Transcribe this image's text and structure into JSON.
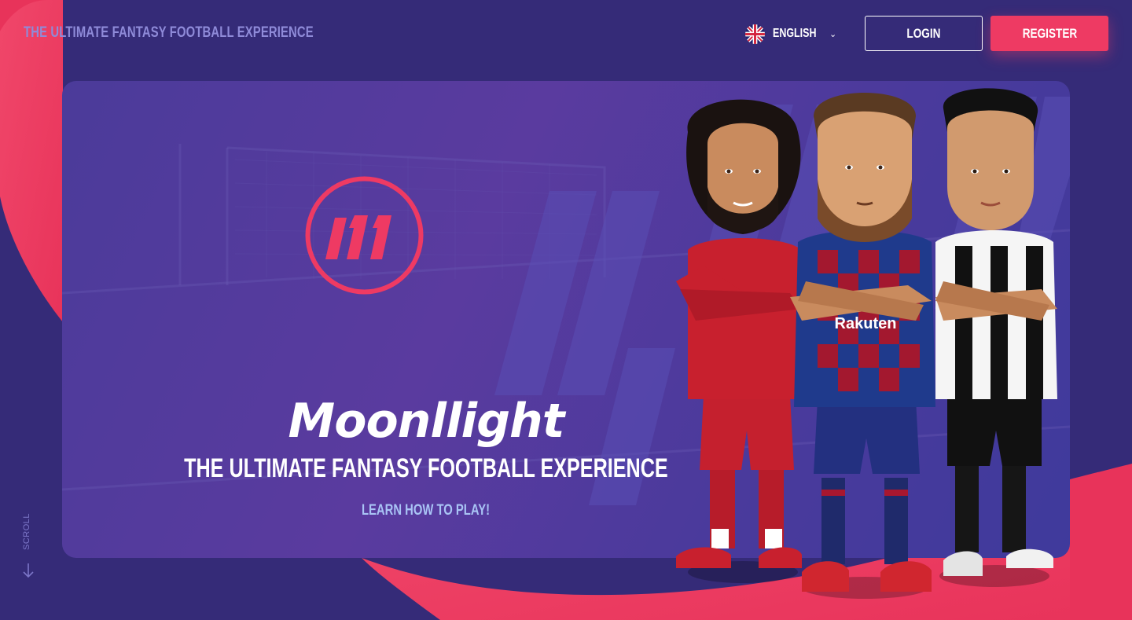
{
  "header": {
    "tagline": "THE ULTIMATE FANTASY FOOTBALL EXPERIENCE",
    "language": {
      "label": "ENGLISH",
      "flag_icon": "uk-flag-icon",
      "chevron_icon": "chevron-down-icon"
    },
    "login_label": "LOGIN",
    "register_label": "REGISTER"
  },
  "hero": {
    "logo_text": "/11",
    "brand_name": "Moonllight",
    "headline": "THE ULTIMATE FANTASY FOOTBALL EXPERIENCE",
    "cta_link": "LEARN HOW TO PLAY!",
    "sponsor_text": "Rakuten"
  },
  "scroll": {
    "label": "SCROLL",
    "icon": "arrow-down-icon"
  },
  "colors": {
    "background": "#352b78",
    "accent": "#ee3a63",
    "tagline": "#8f8bd9",
    "link": "#a9c4f5",
    "card": "#4b3b9a"
  }
}
